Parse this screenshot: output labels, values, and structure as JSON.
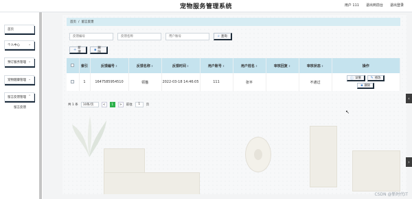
{
  "header": {
    "title": "宠物服务管理系统",
    "user": "用户 111",
    "logout": "退出到前台",
    "exit": "退出登录"
  },
  "sidebar": {
    "items": [
      {
        "label": "首页"
      },
      {
        "label": "个人中心"
      },
      {
        "label": "预订服务管理"
      },
      {
        "label": "宠物健康管理"
      },
      {
        "label": "留言反馈管理"
      }
    ],
    "sub_item": "留言反馈"
  },
  "breadcrumb": {
    "home": "首页",
    "sep": "/",
    "current": "留言反馈"
  },
  "search": {
    "field1_placeholder": "反馈编号",
    "field2_placeholder": "反馈名称",
    "field3_placeholder": "用户账号",
    "button": "查询"
  },
  "actions": {
    "add": "新增",
    "delete": "删除"
  },
  "table": {
    "headers": [
      "索引",
      "反馈编号",
      "反馈名称",
      "反馈时间",
      "用户账号",
      "用户姓名",
      "审核回复",
      "审核状态",
      "操作"
    ],
    "rows": [
      {
        "index": "1",
        "code": "1647585954510",
        "name": "领猫",
        "time": "2022-03-18 14:46:05",
        "account": "111",
        "user_name": "张平",
        "reply": "",
        "status": "不通过",
        "detail": "详情",
        "edit": "修改",
        "delete": "删除"
      }
    ]
  },
  "pagination": {
    "total": "共 1 条",
    "page_size": "10条/页",
    "prev": "<",
    "current": "1",
    "next": ">",
    "goto_label": "前往",
    "goto_value": "1",
    "page_unit": "页"
  },
  "watermark": "CSDN @新时代IT"
}
